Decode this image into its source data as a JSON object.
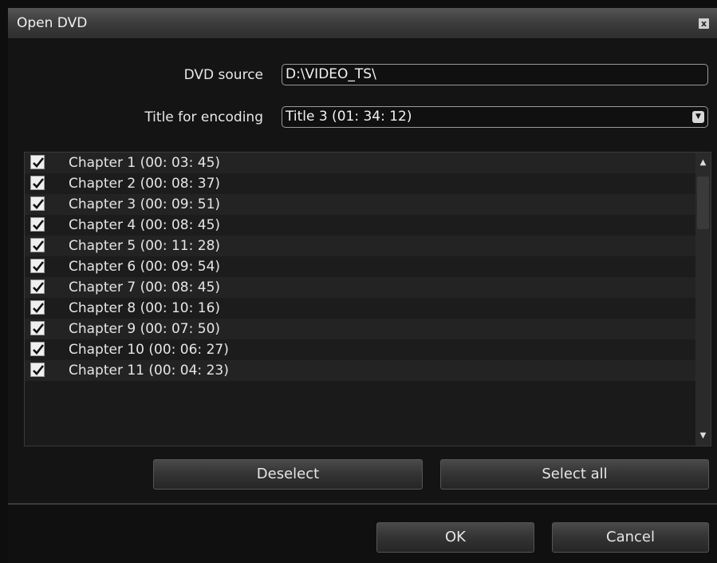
{
  "window": {
    "title": "Open DVD",
    "close_glyph": "x"
  },
  "form": {
    "dvd_source_label": "DVD source",
    "dvd_source_value": "D:\\VIDEO_TS\\",
    "title_label": "Title for encoding",
    "title_value": "Title 3 (01: 34: 12)",
    "title_arrow_icon": "chevron-down-icon"
  },
  "chapters": [
    {
      "label": "Chapter 1 (00: 03: 45)",
      "checked": true
    },
    {
      "label": "Chapter 2 (00: 08: 37)",
      "checked": true
    },
    {
      "label": "Chapter 3 (00: 09: 51)",
      "checked": true
    },
    {
      "label": "Chapter 4 (00: 08: 45)",
      "checked": true
    },
    {
      "label": "Chapter 5 (00: 11: 28)",
      "checked": true
    },
    {
      "label": "Chapter 6 (00: 09: 54)",
      "checked": true
    },
    {
      "label": "Chapter 7 (00: 08: 45)",
      "checked": true
    },
    {
      "label": "Chapter 8 (00: 10: 16)",
      "checked": true
    },
    {
      "label": "Chapter 9 (00: 07: 50)",
      "checked": true
    },
    {
      "label": "Chapter 10 (00: 06: 27)",
      "checked": true
    },
    {
      "label": "Chapter 11 (00: 04: 23)",
      "checked": true
    }
  ],
  "buttons": {
    "deselect": "Deselect",
    "select_all": "Select all",
    "ok": "OK",
    "cancel": "Cancel"
  },
  "colors": {
    "background": "#141414",
    "titlebar": "#3c3c3c",
    "text": "#e6e6e6"
  }
}
